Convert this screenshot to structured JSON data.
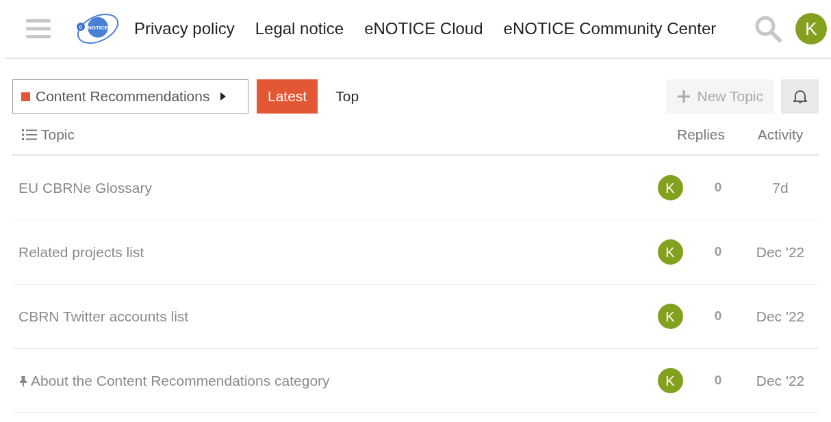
{
  "header": {
    "logo": {
      "small": "e",
      "main": "NOTICE"
    },
    "links": [
      "Privacy policy",
      "Legal notice",
      "eNOTICE Cloud",
      "eNOTICE Community Center"
    ],
    "avatar": "K"
  },
  "category": {
    "label": "Content Recommendations",
    "color": "#e45735"
  },
  "tabs": [
    {
      "label": "Latest",
      "selected": true
    },
    {
      "label": "Top",
      "selected": false
    }
  ],
  "new_topic": {
    "label": "New Topic",
    "disabled": true
  },
  "table": {
    "columns": [
      "Topic",
      "Replies",
      "Activity"
    ],
    "rows": [
      {
        "title": "EU CBRNe Glossary",
        "pinned": false,
        "avatar": "K",
        "replies": "0",
        "activity": "7d"
      },
      {
        "title": "Related projects list",
        "pinned": false,
        "avatar": "K",
        "replies": "0",
        "activity": "Dec '22"
      },
      {
        "title": "CBRN Twitter accounts list",
        "pinned": false,
        "avatar": "K",
        "replies": "0",
        "activity": "Dec '22"
      },
      {
        "title": "About the Content Recommendations category",
        "pinned": true,
        "avatar": "K",
        "replies": "0",
        "activity": "Dec '22"
      }
    ]
  }
}
